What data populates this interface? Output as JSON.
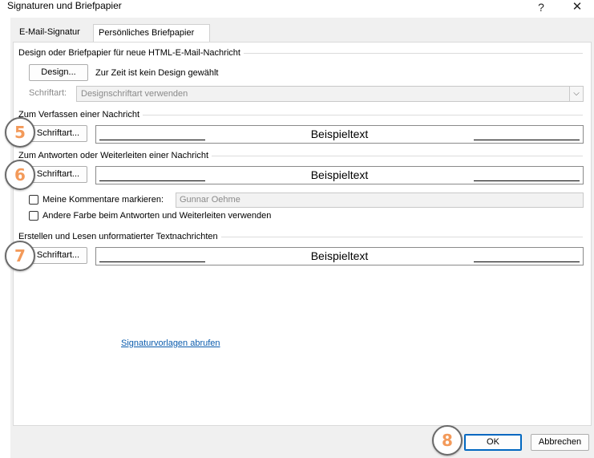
{
  "window": {
    "title": "Signaturen und Briefpapier",
    "help_glyph": "?",
    "close_glyph": "✕"
  },
  "tabs": [
    {
      "label": "E-Mail-Signatur",
      "selected": false
    },
    {
      "label": "Persönliches Briefpapier",
      "selected": true
    }
  ],
  "design_group": {
    "label": "Design oder Briefpapier für neue HTML-E-Mail-Nachricht",
    "design_button": "Design...",
    "status_text": "Zur Zeit ist kein Design gewählt",
    "font_label": "Schriftart:",
    "font_select_value": "Designschriftart verwenden"
  },
  "compose_group": {
    "label": "Zum Verfassen einer Nachricht",
    "font_button": "Schriftart...",
    "preview_text": "Beispieltext"
  },
  "reply_group": {
    "label": "Zum Antworten oder Weiterleiten einer Nachricht",
    "font_button": "Schriftart...",
    "preview_text": "Beispieltext",
    "mark_comments_label": "Meine Kommentare markieren:",
    "mark_comments_checked": false,
    "mark_comments_name": "Gunnar Oehme",
    "other_color_label": "Andere Farbe beim Antworten und Weiterleiten verwenden",
    "other_color_checked": false
  },
  "plain_group": {
    "label": "Erstellen und Lesen unformatierter Textnachrichten",
    "font_button": "Schriftart...",
    "preview_text": "Beispieltext"
  },
  "templates_link": "Signaturvorlagen abrufen",
  "footer": {
    "ok_label": "OK",
    "cancel_label": "Abbrechen"
  },
  "callouts": [
    {
      "number": "5"
    },
    {
      "number": "6"
    },
    {
      "number": "7"
    },
    {
      "number": "8"
    }
  ],
  "colors": {
    "callout_digit": "#f39a5a",
    "link": "#0b5cad",
    "dialog_bg": "#f0f0f0",
    "ok_focus": "#0067c0"
  }
}
